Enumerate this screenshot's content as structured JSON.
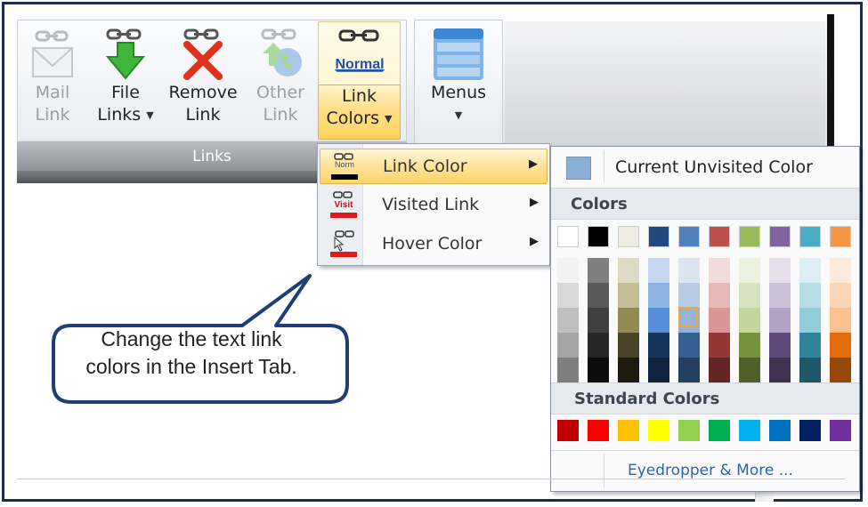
{
  "ribbon": {
    "group_links_label": "Links",
    "buttons": {
      "mail_link": {
        "line1": "Mail",
        "line2": "Link"
      },
      "file_links": {
        "line1": "File",
        "line2": "Links"
      },
      "remove_link": {
        "line1": "Remove",
        "line2": "Link"
      },
      "other_link": {
        "line1": "Other",
        "line2": "Link"
      },
      "link_colors": {
        "line1": "Link",
        "line2": "Colors",
        "icon_text": "Normal"
      },
      "menus": {
        "line1": "Menus"
      }
    }
  },
  "menu": {
    "items": [
      {
        "label": "Link Color",
        "icon_text": "Norm",
        "bar_color": "#000000"
      },
      {
        "label": "Visited Link",
        "icon_text": "Visit",
        "bar_color": "#e01b1b"
      },
      {
        "label": "Hover Color",
        "icon_text": "",
        "bar_color": "#e01b1b"
      }
    ]
  },
  "picker": {
    "current_label": "Current Unvisited Color",
    "current_color": "#8ab0d8",
    "colors_heading": "Colors",
    "standard_heading": "Standard Colors",
    "eyedropper_label": "Eyedropper & More ...",
    "theme_top": [
      "#ffffff",
      "#000000",
      "#eeece1",
      "#1f497d",
      "#4f81bd",
      "#c0504d",
      "#9bbb59",
      "#8064a2",
      "#4bacc6",
      "#f79646"
    ],
    "theme_shades": [
      [
        "#f2f2f2",
        "#d8d8d8",
        "#bfbfbf",
        "#a5a5a5",
        "#7f7f7f"
      ],
      [
        "#7f7f7f",
        "#595959",
        "#3f3f3f",
        "#262626",
        "#0c0c0c"
      ],
      [
        "#ddd9c3",
        "#c4bd97",
        "#938953",
        "#494429",
        "#1d1b10"
      ],
      [
        "#c6d9f0",
        "#8db3e2",
        "#548dd4",
        "#17365d",
        "#0f243e"
      ],
      [
        "#dbe5f1",
        "#b8cce4",
        "#95b3d7",
        "#366092",
        "#244061"
      ],
      [
        "#f2dcdb",
        "#e5b9b7",
        "#d99694",
        "#953734",
        "#632423"
      ],
      [
        "#ebf1dd",
        "#d7e3bc",
        "#c3d69b",
        "#76923c",
        "#4f6128"
      ],
      [
        "#e5e0ec",
        "#ccc1d9",
        "#b2a2c7",
        "#5f497a",
        "#3f3151"
      ],
      [
        "#dbeef3",
        "#b7dde8",
        "#92cddc",
        "#31859b",
        "#205867"
      ],
      [
        "#fdeada",
        "#fbd5b5",
        "#fac08f",
        "#e36c09",
        "#974806"
      ]
    ],
    "standard": [
      "#c00000",
      "#ff0000",
      "#ffc000",
      "#ffff00",
      "#92d050",
      "#00b050",
      "#00b0f0",
      "#0070c0",
      "#002060",
      "#7030a0"
    ]
  },
  "callout": {
    "line1": "Change the text link",
    "line2": "colors in the Insert Tab."
  }
}
